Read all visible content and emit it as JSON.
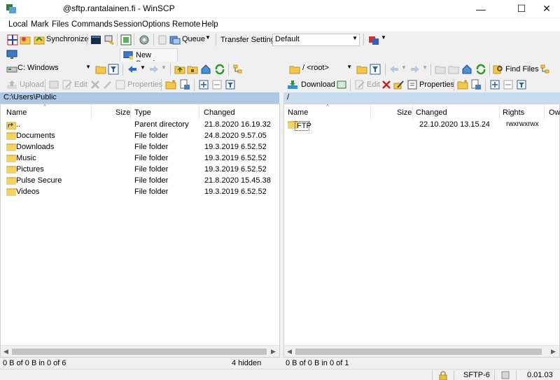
{
  "window": {
    "title": "@sftp.rantalainen.fi - WinSCP",
    "minimize_glyph": "—",
    "maximize_glyph": "☐",
    "close_glyph": "✕"
  },
  "menu": [
    "Local",
    "Mark",
    "Files",
    "Commands",
    "Session",
    "Options",
    "Remote",
    "Help"
  ],
  "toolbar": {
    "synchronize": "Synchronize",
    "queue": "Queue",
    "transfer_settings_label": "Transfer Settings",
    "transfer_settings_value": "Default"
  },
  "session": {
    "new_session": "New Session"
  },
  "local": {
    "drive": "C: Windows",
    "upload": "Upload",
    "edit": "Edit",
    "properties": "Properties",
    "path": "C:\\Users\\Public",
    "columns": [
      "Name",
      "Size",
      "Type",
      "Changed"
    ],
    "rows": [
      {
        "name": "..",
        "size": "",
        "type": "Parent directory",
        "changed": "21.8.2020  16.19.32"
      },
      {
        "name": "Documents",
        "size": "",
        "type": "File folder",
        "changed": "24.8.2020  9.57.05"
      },
      {
        "name": "Downloads",
        "size": "",
        "type": "File folder",
        "changed": "19.3.2019  6.52.52"
      },
      {
        "name": "Music",
        "size": "",
        "type": "File folder",
        "changed": "19.3.2019  6.52.52"
      },
      {
        "name": "Pictures",
        "size": "",
        "type": "File folder",
        "changed": "19.3.2019  6.52.52"
      },
      {
        "name": "Pulse Secure",
        "size": "",
        "type": "File folder",
        "changed": "21.8.2020  15.45.38"
      },
      {
        "name": "Videos",
        "size": "",
        "type": "File folder",
        "changed": "19.3.2019  6.52.52"
      }
    ],
    "status": "0 B of 0 B in 0 of 6",
    "hidden": "4 hidden"
  },
  "remote": {
    "path_combo": "/ <root>",
    "download": "Download",
    "edit": "Edit",
    "properties": "Properties",
    "find_files": "Find Files",
    "path": "/",
    "columns": [
      "Name",
      "Size",
      "Changed",
      "Rights",
      "Ow"
    ],
    "rows": [
      {
        "name": "FTP",
        "size": "",
        "changed": "22.10.2020  13.15.24",
        "rights": "rwxrwxrwx"
      }
    ],
    "status": "0 B of 0 B in 0 of 1"
  },
  "statusbar": {
    "protocol": "SFTP-6",
    "time": "0.01.03"
  }
}
